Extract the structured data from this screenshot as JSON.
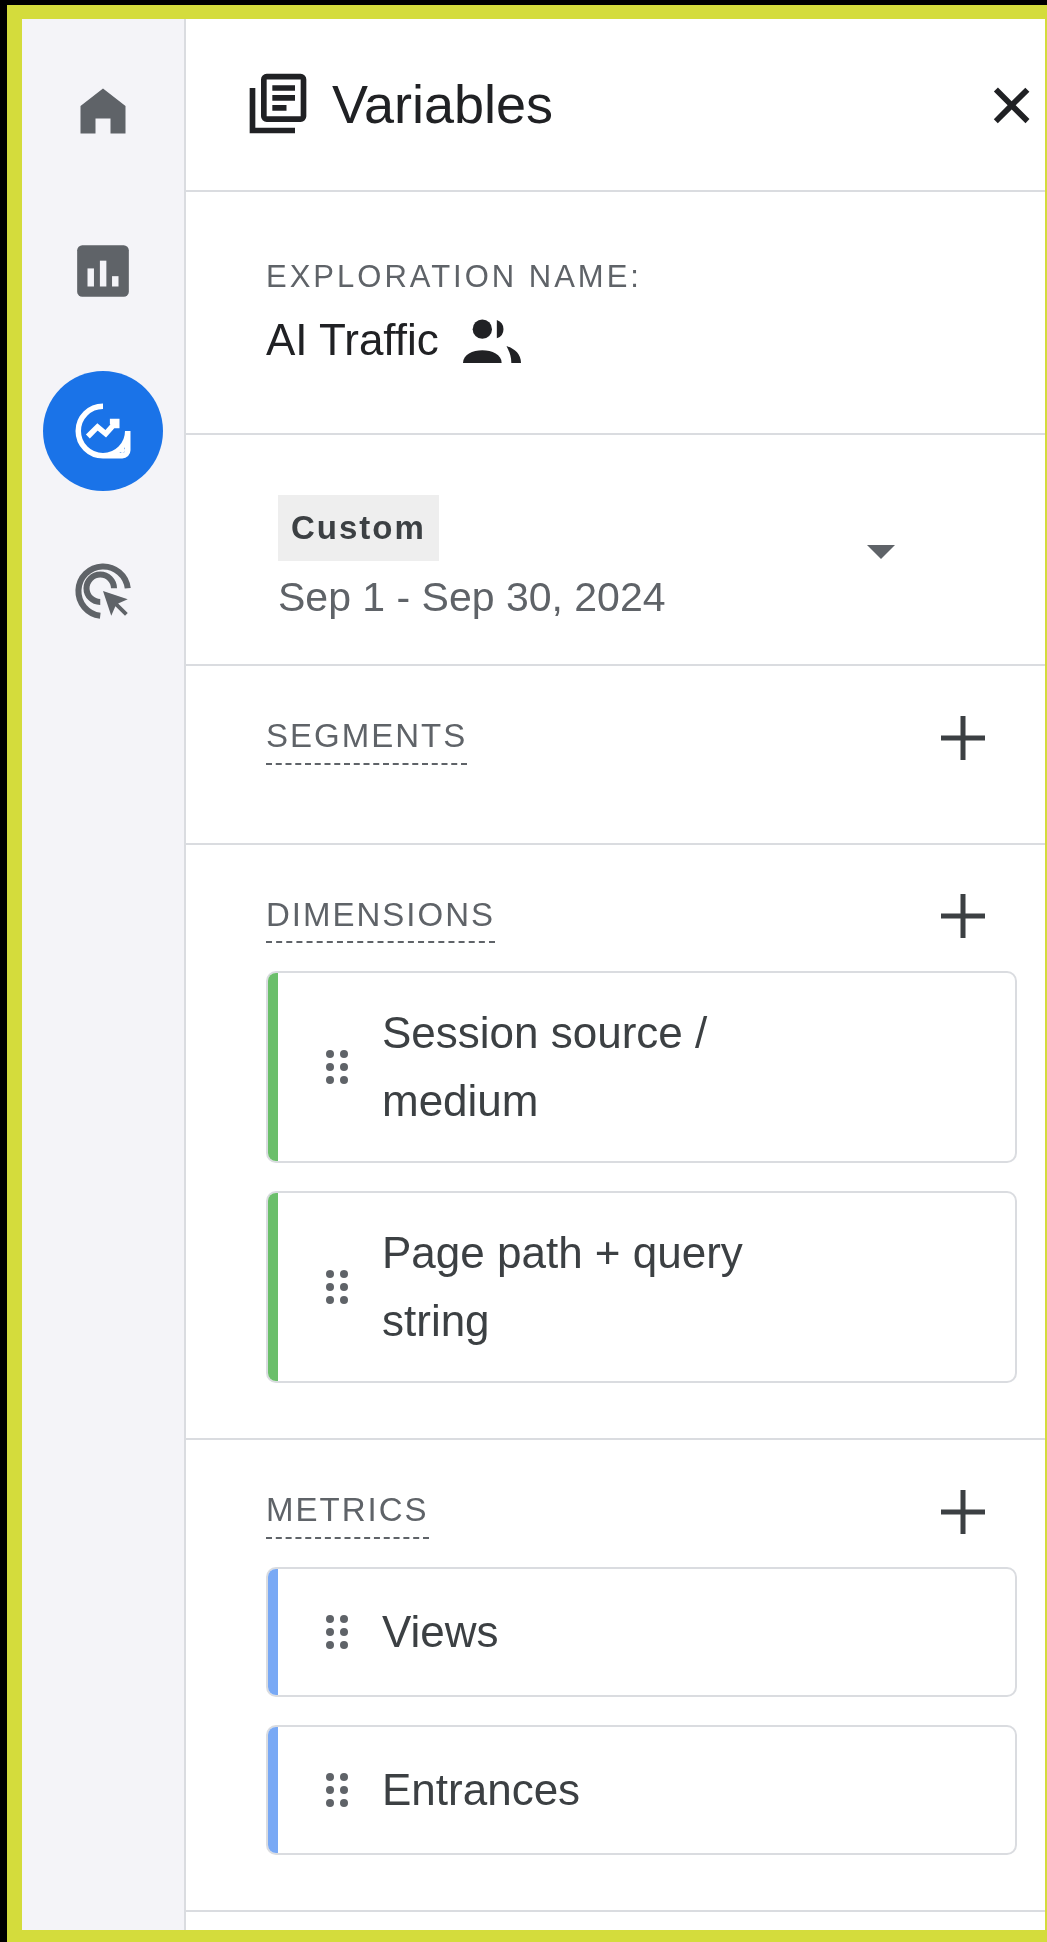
{
  "sidebar": {
    "items": [
      {
        "kind": "home",
        "selected": false
      },
      {
        "kind": "reports",
        "selected": false
      },
      {
        "kind": "explore",
        "selected": true
      },
      {
        "kind": "advertising",
        "selected": false
      }
    ]
  },
  "panel": {
    "title": "Variables",
    "close": "×"
  },
  "exploration": {
    "label": "EXPLORATION NAME:",
    "name": "AI Traffic"
  },
  "date_range": {
    "chip": "Custom",
    "value": "Sep 1 - Sep 30, 2024"
  },
  "sections": [
    {
      "title": "SEGMENTS"
    },
    {
      "title": "DIMENSIONS",
      "items": [
        {
          "label": "Session source / medium",
          "color": "#6bbf6b"
        },
        {
          "label": "Page path + query string",
          "color": "#6bbf6b"
        }
      ]
    },
    {
      "title": "METRICS",
      "items": [
        {
          "label": "Views",
          "color": "#79a9f5"
        },
        {
          "label": "Entrances",
          "color": "#79a9f5"
        }
      ]
    }
  ]
}
